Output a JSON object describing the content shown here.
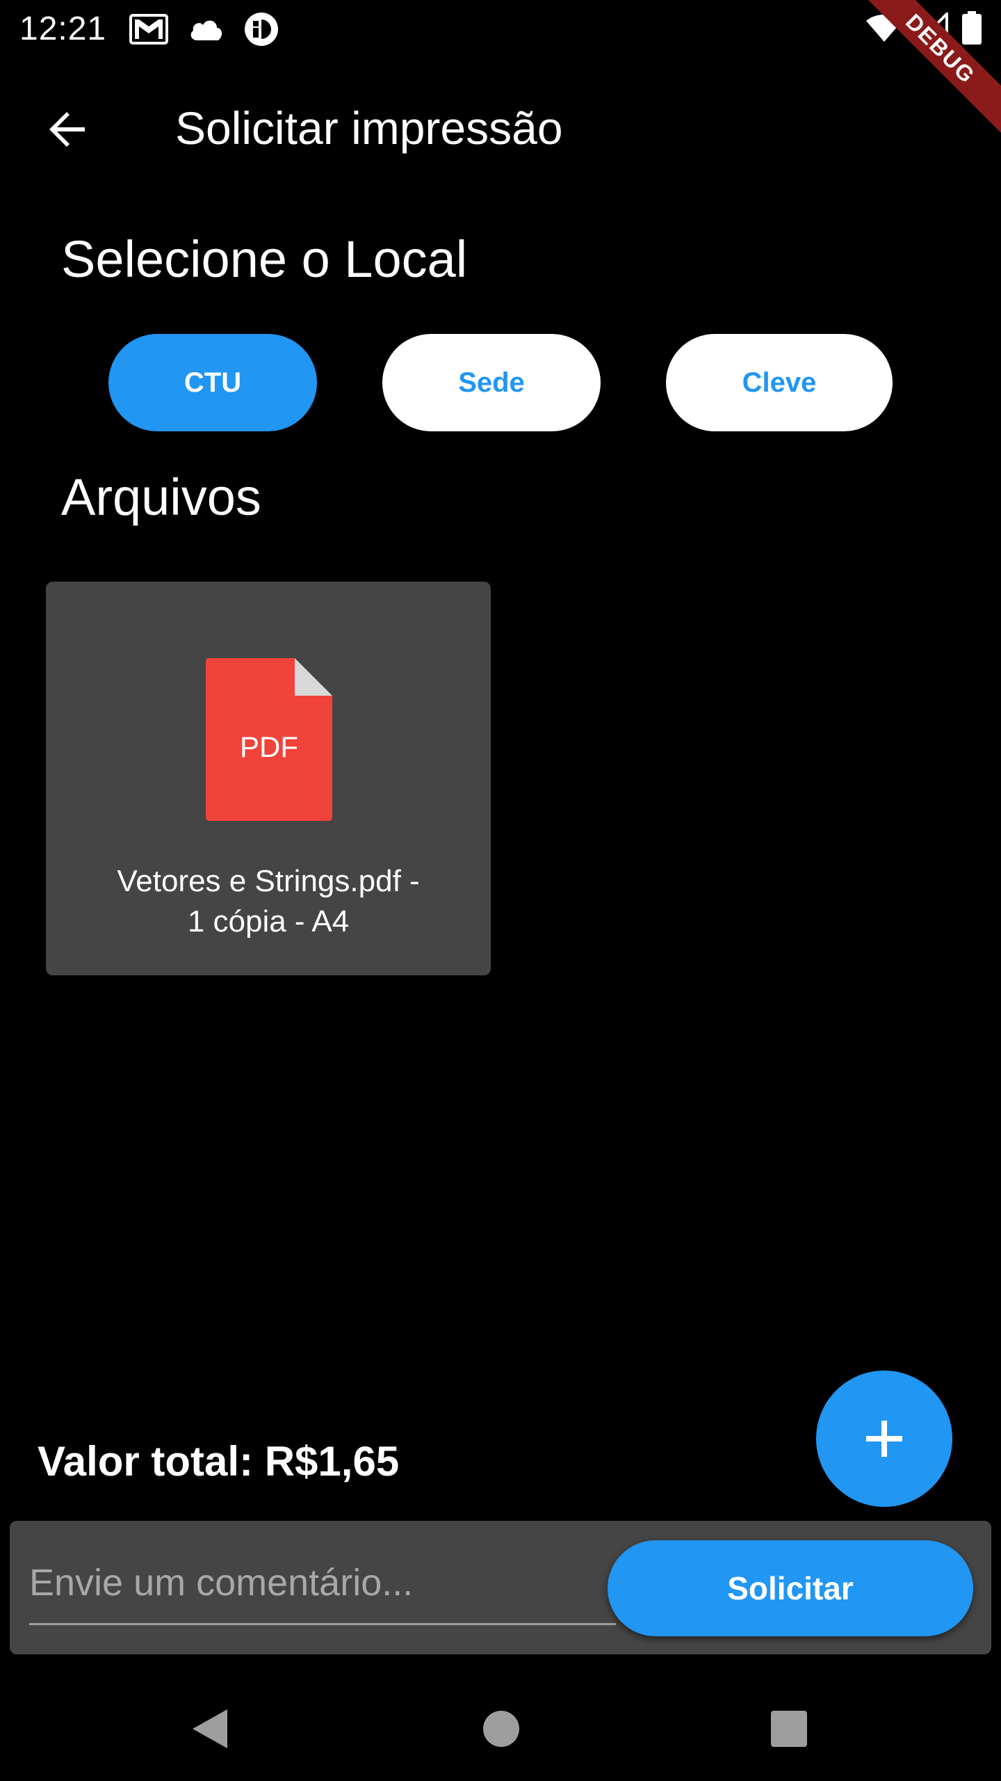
{
  "status_bar": {
    "time": "12:21",
    "left_icons": [
      "gmail-icon",
      "cloud-icon",
      "app-notification-icon"
    ],
    "right_icons": [
      "wifi-icon",
      "signal-icon",
      "battery-icon"
    ],
    "debug_label": "DEBUG"
  },
  "app_bar": {
    "title": "Solicitar impressão",
    "back_icon": "arrow-back-icon"
  },
  "location_section": {
    "title": "Selecione o Local",
    "options": [
      {
        "label": "CTU",
        "selected": true
      },
      {
        "label": "Sede",
        "selected": false
      },
      {
        "label": "Cleve",
        "selected": false
      }
    ]
  },
  "files_section": {
    "title": "Arquivos",
    "files": [
      {
        "icon_label": "PDF",
        "name_line1": "Vetores e Strings.pdf -",
        "name_line2": "1 cópia - A4"
      }
    ]
  },
  "total": {
    "label": "Valor total: R$1,65"
  },
  "fab": {
    "icon": "plus-icon"
  },
  "comment": {
    "placeholder": "Envie um comentário...",
    "value": ""
  },
  "submit": {
    "label": "Solicitar"
  },
  "colors": {
    "accent": "#2196f3",
    "card": "#454545",
    "pdf_red": "#f0433a",
    "background": "#000000"
  }
}
